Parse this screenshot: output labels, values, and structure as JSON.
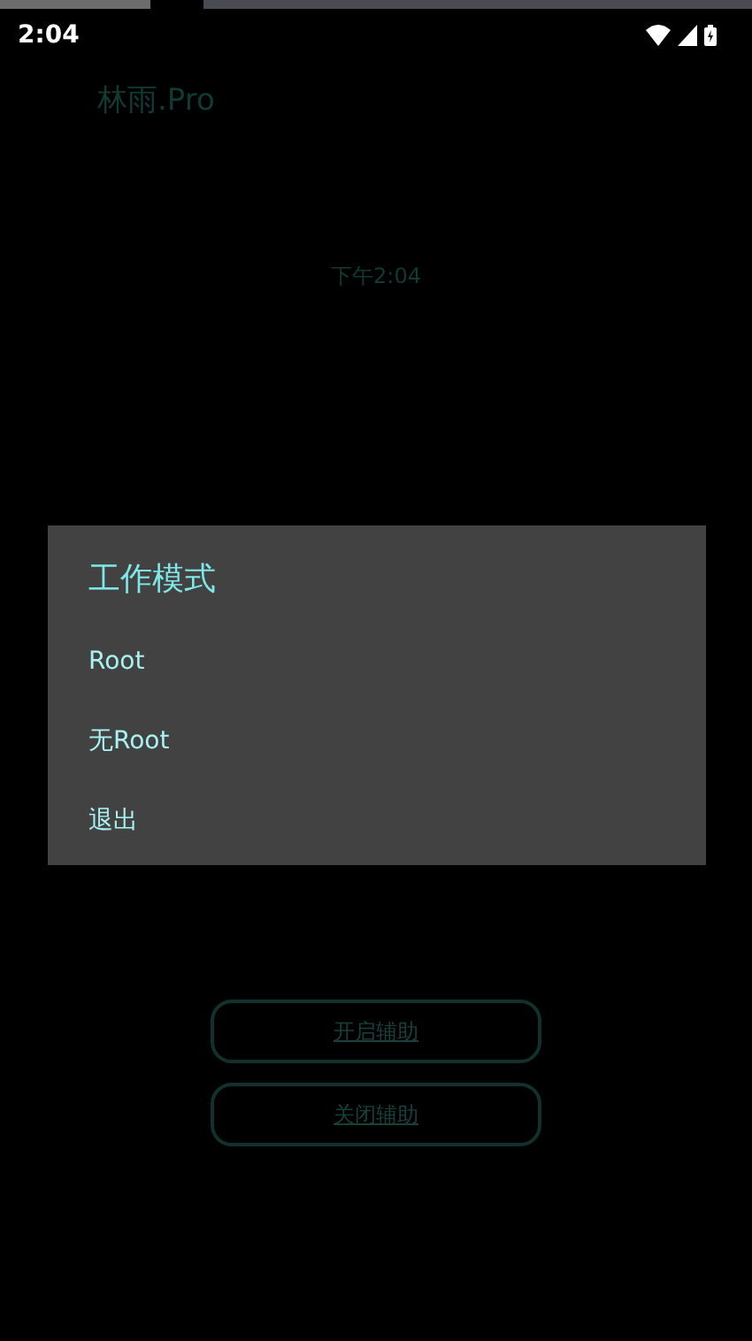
{
  "status_bar": {
    "time": "2:04"
  },
  "app": {
    "title": "林雨.Pro",
    "clock": "下午2:04"
  },
  "dialog": {
    "title": "工作模式",
    "options": [
      {
        "label": "Root"
      },
      {
        "label": "无Root"
      },
      {
        "label": "退出"
      }
    ]
  },
  "buttons": [
    {
      "label": "开启辅助"
    },
    {
      "label": "关闭辅助"
    }
  ]
}
